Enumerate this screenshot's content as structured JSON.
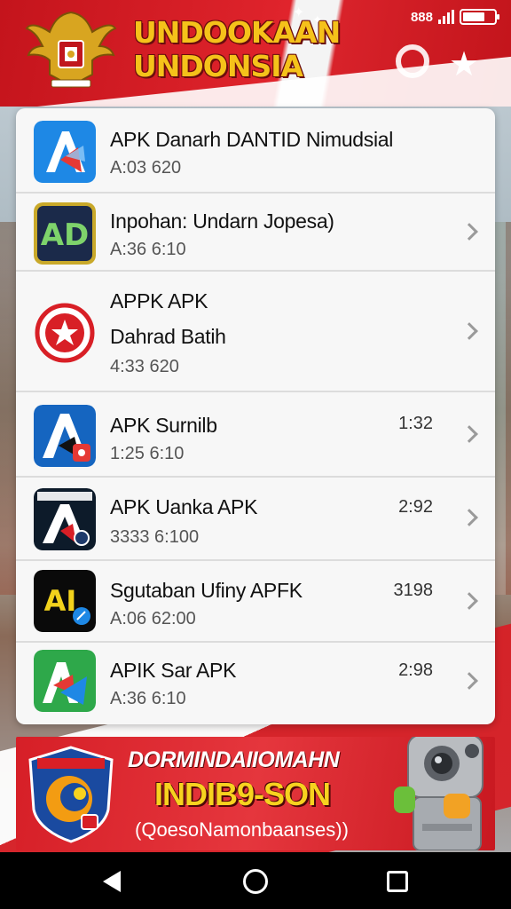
{
  "status_bar": {
    "time": "888",
    "signal_icon": "signal-icon",
    "battery_icon": "battery-icon"
  },
  "header": {
    "title_line1": "UNDOOKAAN",
    "title_line2": "UNDONSIA",
    "emblem_icon": "garuda-emblem-icon",
    "accent_color": "#d81f26",
    "title_color": "#f5c21a"
  },
  "apps": [
    {
      "title": "APK Danarh DANTID Nimudsial",
      "subtitle": "A:03  620",
      "time": "",
      "icon": "apk-a-blue-icon",
      "has_chevron": false
    },
    {
      "title": "Inpohan: Undarn Jopesa)",
      "subtitle": "A:36  6:10",
      "time": "",
      "icon": "ad-navy-icon",
      "has_chevron": true
    },
    {
      "title": "APPK APK",
      "title2": "Dahrad Batih",
      "subtitle": "4:33  620",
      "time": "",
      "icon": "red-star-circle-icon",
      "has_chevron": true
    },
    {
      "title": "APK Surnilb",
      "subtitle": "1:25  6:10",
      "time": "1:32",
      "icon": "apk-a-red-badge-icon",
      "has_chevron": true
    },
    {
      "title": "APK Uanka APK",
      "subtitle": "3333  6:100",
      "time": "2:92",
      "icon": "apk-a-dark-icon",
      "has_chevron": true
    },
    {
      "title": "Sgutaban Ufiny APFK",
      "subtitle": "A:06  62:00",
      "time": "3198",
      "icon": "ai-black-icon",
      "has_chevron": true
    },
    {
      "title": "APIK Sar APK",
      "subtitle": "A:36  6:10",
      "time": "2:98",
      "icon": "ap-green-icon",
      "has_chevron": true
    }
  ],
  "ad": {
    "line1": "DORMINDAIIOMAHN",
    "line2": "INDIB9-SON",
    "line3": "(QoesoNamonbaanses))",
    "shield_icon": "shield-logo-icon",
    "robot_icon": "robot-camera-icon"
  },
  "navbar": {
    "back_icon": "back-triangle-icon",
    "home_icon": "home-circle-icon",
    "recents_icon": "recents-square-icon"
  }
}
